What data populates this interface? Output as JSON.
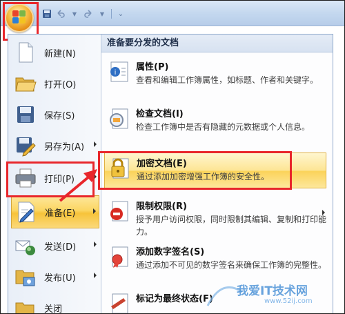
{
  "menu": {
    "left_items": [
      {
        "label": "新建(N)",
        "has_arrow": false,
        "icon": "new-doc-icon"
      },
      {
        "label": "打开(O)",
        "has_arrow": false,
        "icon": "open-folder-icon"
      },
      {
        "label": "保存(S)",
        "has_arrow": false,
        "icon": "save-icon"
      },
      {
        "label": "另存为(A)",
        "has_arrow": true,
        "icon": "save-as-icon"
      },
      {
        "label": "打印(P)",
        "has_arrow": true,
        "icon": "print-icon"
      },
      {
        "label": "准备(E)",
        "has_arrow": true,
        "icon": "prepare-icon"
      },
      {
        "label": "发送(D)",
        "has_arrow": true,
        "icon": "send-icon"
      },
      {
        "label": "发布(U)",
        "has_arrow": true,
        "icon": "publish-icon"
      },
      {
        "label": "关闭",
        "has_arrow": false,
        "icon": "close-doc-icon"
      }
    ],
    "selected_index": 5,
    "right_header": "准备要分发的文档",
    "right_items": [
      {
        "title": "属性(P)",
        "desc": "查看和编辑工作簿属性，如标题、作者和关键字。",
        "icon": "properties-icon"
      },
      {
        "title": "检查文档(I)",
        "desc": "检查工作簿中是否有隐藏的元数据或个人信息。",
        "icon": "inspect-document-icon"
      },
      {
        "title": "加密文档(E)",
        "desc": "通过添加加密增强工作簿的安全性。",
        "icon": "encrypt-lock-icon"
      },
      {
        "title": "限制权限(R)",
        "desc": "授予用户访问权限，同时限制其编辑、复制和打印能力。",
        "icon": "restrict-permission-icon"
      },
      {
        "title": "添加数字签名(S)",
        "desc": "通过添加不可见的数字签名来确保工作簿的完整性。",
        "icon": "digital-signature-icon"
      },
      {
        "title": "标记为最终状态(F)",
        "desc": "",
        "icon": "mark-final-icon"
      }
    ],
    "highlighted_index": 2
  },
  "watermark": {
    "text": "我爱IT技术网",
    "subtext": "www.52ij.com"
  },
  "colors": {
    "highlight_border": "#e8262b",
    "menu_selected": "#fbd663",
    "ribbon_blue": "#c4d8ef"
  }
}
